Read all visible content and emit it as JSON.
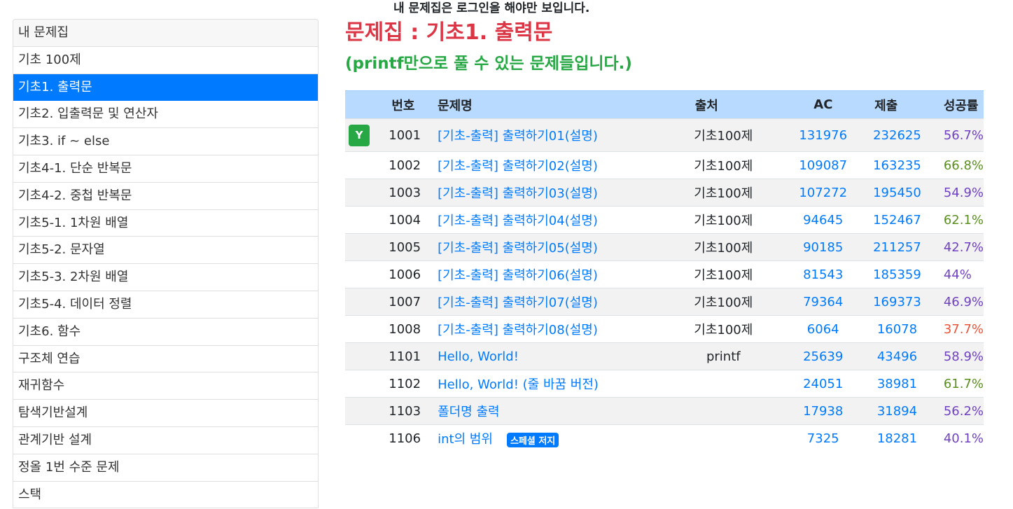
{
  "notice": "내 문제집은 로그인을 해야만 보입니다.",
  "sidebar": {
    "items": [
      {
        "label": "내 문제집"
      },
      {
        "label": "기초 100제"
      },
      {
        "label": "기초1. 출력문"
      },
      {
        "label": "기초2. 입출력문 및 연산자"
      },
      {
        "label": "기초3. if ~ else"
      },
      {
        "label": "기초4-1. 단순 반복문"
      },
      {
        "label": "기초4-2. 중첩 반복문"
      },
      {
        "label": "기초5-1. 1차원 배열"
      },
      {
        "label": "기초5-2. 문자열"
      },
      {
        "label": "기초5-3. 2차원 배열"
      },
      {
        "label": "기초5-4. 데이터 정렬"
      },
      {
        "label": "기초6. 함수"
      },
      {
        "label": "구조체 연습"
      },
      {
        "label": "재귀함수"
      },
      {
        "label": "탐색기반설계"
      },
      {
        "label": "관계기반 설계"
      },
      {
        "label": "정올 1번 수준 문제"
      },
      {
        "label": "스택"
      }
    ],
    "active_index": 2
  },
  "main": {
    "title": "문제집 : 기초1. 출력문",
    "subtitle": "(printf만으로 풀 수 있는 문제들입니다.)",
    "columns": {
      "no": "번호",
      "title": "문제명",
      "source": "출처",
      "ac": "AC",
      "submit": "제출",
      "rate": "성공률"
    },
    "rows": [
      {
        "badge": "Y",
        "no": "1001",
        "title": "[기초-출력] 출력하기01(설명)",
        "source": "기초100제",
        "ac": "131976",
        "submit": "232625",
        "rate": "56.7%",
        "rate_color": "#6f42c1",
        "tag": ""
      },
      {
        "badge": "",
        "no": "1002",
        "title": "[기초-출력] 출력하기02(설명)",
        "source": "기초100제",
        "ac": "109087",
        "submit": "163235",
        "rate": "66.8%",
        "rate_color": "#5a8f1e",
        "tag": ""
      },
      {
        "badge": "",
        "no": "1003",
        "title": "[기초-출력] 출력하기03(설명)",
        "source": "기초100제",
        "ac": "107272",
        "submit": "195450",
        "rate": "54.9%",
        "rate_color": "#6f42c1",
        "tag": ""
      },
      {
        "badge": "",
        "no": "1004",
        "title": "[기초-출력] 출력하기04(설명)",
        "source": "기초100제",
        "ac": "94645",
        "submit": "152467",
        "rate": "62.1%",
        "rate_color": "#5a8f1e",
        "tag": ""
      },
      {
        "badge": "",
        "no": "1005",
        "title": "[기초-출력] 출력하기05(설명)",
        "source": "기초100제",
        "ac": "90185",
        "submit": "211257",
        "rate": "42.7%",
        "rate_color": "#6f42c1",
        "tag": ""
      },
      {
        "badge": "",
        "no": "1006",
        "title": "[기초-출력] 출력하기06(설명)",
        "source": "기초100제",
        "ac": "81543",
        "submit": "185359",
        "rate": "44%",
        "rate_color": "#6f42c1",
        "tag": ""
      },
      {
        "badge": "",
        "no": "1007",
        "title": "[기초-출력] 출력하기07(설명)",
        "source": "기초100제",
        "ac": "79364",
        "submit": "169373",
        "rate": "46.9%",
        "rate_color": "#6f42c1",
        "tag": ""
      },
      {
        "badge": "",
        "no": "1008",
        "title": "[기초-출력] 출력하기08(설명)",
        "source": "기초100제",
        "ac": "6064",
        "submit": "16078",
        "rate": "37.7%",
        "rate_color": "#e8553a",
        "tag": ""
      },
      {
        "badge": "",
        "no": "1101",
        "title": "Hello, World!",
        "source": "printf",
        "ac": "25639",
        "submit": "43496",
        "rate": "58.9%",
        "rate_color": "#6f42c1",
        "tag": ""
      },
      {
        "badge": "",
        "no": "1102",
        "title": "Hello, World! (줄 바꿈 버전)",
        "source": "",
        "ac": "24051",
        "submit": "38981",
        "rate": "61.7%",
        "rate_color": "#5a8f1e",
        "tag": ""
      },
      {
        "badge": "",
        "no": "1103",
        "title": "폴더명 출력",
        "source": "",
        "ac": "17938",
        "submit": "31894",
        "rate": "56.2%",
        "rate_color": "#6f42c1",
        "tag": ""
      },
      {
        "badge": "",
        "no": "1106",
        "title": "int의 범위",
        "source": "",
        "ac": "7325",
        "submit": "18281",
        "rate": "40.1%",
        "rate_color": "#6f42c1",
        "tag": "스페셜 저지"
      }
    ]
  },
  "colors": {
    "accent": "#007bff",
    "title_red": "#dc3545",
    "subtitle_green": "#28a745",
    "header_blue": "#b8daff"
  }
}
